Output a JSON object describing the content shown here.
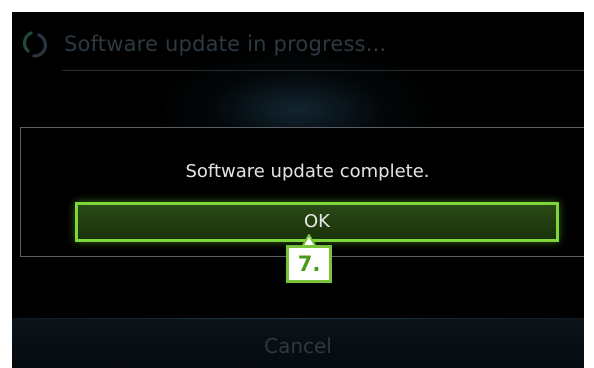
{
  "header": {
    "title": "Software update in progress...",
    "icon": "spinner-icon"
  },
  "dialog": {
    "message": "Software update complete.",
    "ok_label": "OK"
  },
  "annotation": {
    "step_label": "7."
  },
  "footer": {
    "cancel_label": "Cancel"
  },
  "colors": {
    "accent_green": "#7ed63a",
    "button_fill": "#234211",
    "dim_text": "#2d3942",
    "background": "#000000"
  }
}
